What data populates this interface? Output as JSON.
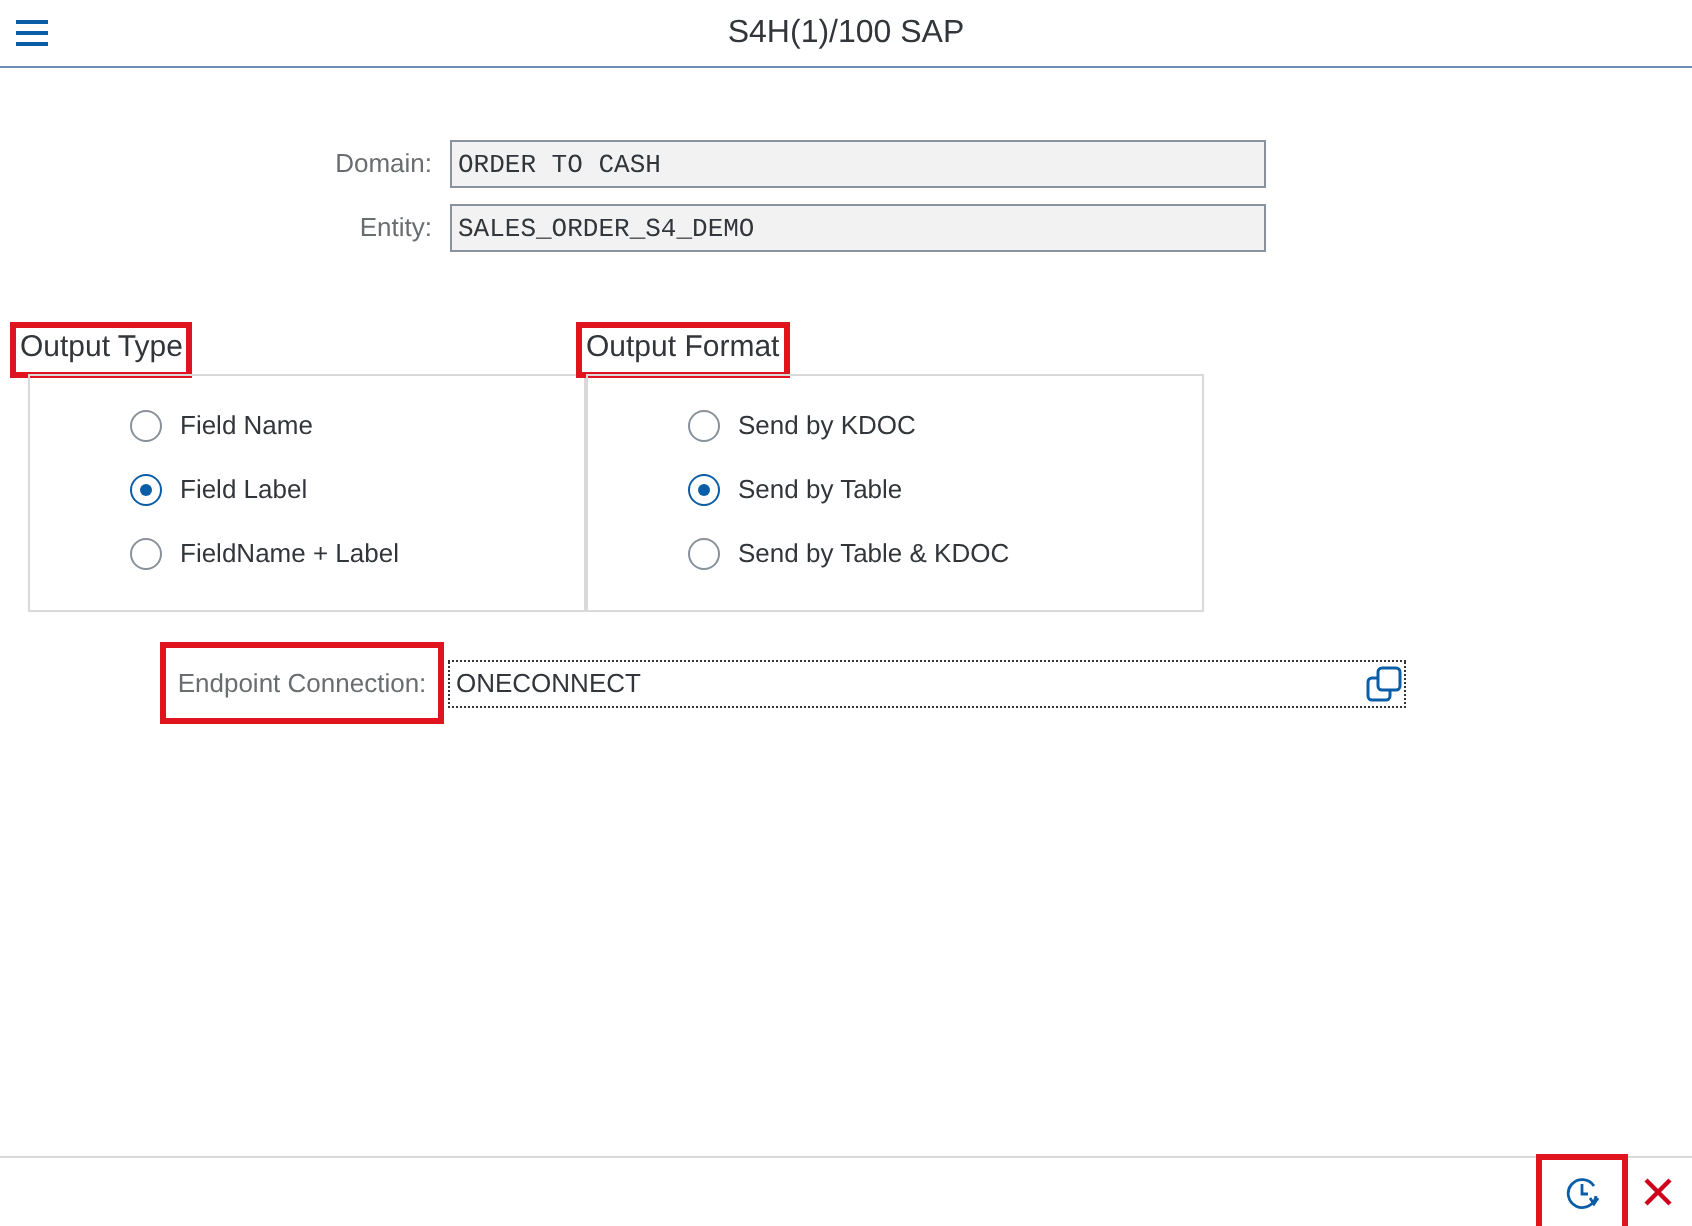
{
  "window": {
    "title": "S4H(1)/100 SAP"
  },
  "fields": [
    {
      "label": "Domain:",
      "value": "ORDER TO CASH"
    },
    {
      "label": "Entity:",
      "value": "SALES_ORDER_S4_DEMO"
    }
  ],
  "groups": [
    {
      "title": "Output Type",
      "highlighted": true,
      "options": [
        {
          "label": "Field Name",
          "selected": false
        },
        {
          "label": "Field Label",
          "selected": true
        },
        {
          "label": "FieldName + Label",
          "selected": false
        }
      ]
    },
    {
      "title": "Output Format",
      "highlighted": true,
      "options": [
        {
          "label": "Send by KDOC",
          "selected": false
        },
        {
          "label": "Send by Table",
          "selected": true
        },
        {
          "label": "Send by Table & KDOC",
          "selected": false
        }
      ]
    }
  ],
  "endpoint": {
    "label": "Endpoint Connection:",
    "value": "ONECONNECT",
    "highlighted": true
  },
  "footer": {
    "history_highlighted": true
  }
}
